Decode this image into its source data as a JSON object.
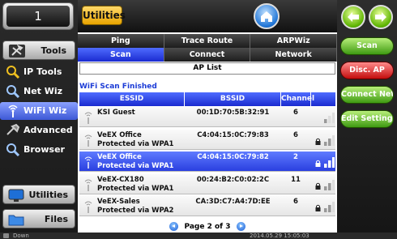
{
  "left_panel": {
    "port_label": "1",
    "tools_label": "Tools",
    "nav": [
      {
        "label": "IP Tools",
        "icon": "ip-tools-icon"
      },
      {
        "label": "Net Wiz",
        "icon": "net-wiz-icon"
      },
      {
        "label": "WiFi Wiz",
        "icon": "wifi-icon"
      },
      {
        "label": "Advanced",
        "icon": "advanced-icon"
      },
      {
        "label": "Browser",
        "icon": "browser-icon"
      }
    ],
    "utilities_label": "Utilities",
    "files_label": "Files"
  },
  "top_bar": {
    "app_title": "Utilities"
  },
  "tabs": {
    "row1": [
      "Ping",
      "Trace Route",
      "ARPWiz"
    ],
    "row2": [
      "Scan",
      "Connect",
      "Network"
    ],
    "active_row2": "Scan"
  },
  "ap_list": {
    "title": "AP List",
    "status": "WiFi Scan Finished",
    "columns": [
      "ESSID",
      "BSSID",
      "Channel"
    ],
    "rows": [
      {
        "essid": "KSI Guest",
        "security": "",
        "bssid": "00:1D:70:5B:32:91",
        "channel": "6",
        "locked": false,
        "signal": 1,
        "selected": false
      },
      {
        "essid": "VeEX Office",
        "security": "Protected via WPA1",
        "bssid": "C4:04:15:0C:79:83",
        "channel": "6",
        "locked": true,
        "signal": 2,
        "selected": false
      },
      {
        "essid": "VeEX Office",
        "security": "Protected via WPA1",
        "bssid": "C4:04:15:0C:79:82",
        "channel": "2",
        "locked": true,
        "signal": 3,
        "selected": true
      },
      {
        "essid": "VeEX-CX180",
        "security": "Protected via WPA1",
        "bssid": "00:24:B2:C0:02:2C",
        "channel": "11",
        "locked": true,
        "signal": 2,
        "selected": false
      },
      {
        "essid": "VeEX-Sales",
        "security": "Protected via WPA2",
        "bssid": "CA:3D:C7:A4:7D:EE",
        "channel": "6",
        "locked": true,
        "signal": 2,
        "selected": false
      }
    ],
    "pager": "Page 2 of 3"
  },
  "right_panel": {
    "buttons": [
      {
        "label": "Scan",
        "color": "green"
      },
      {
        "label": "Disc. AP",
        "color": "red"
      },
      {
        "label": "Connect Net",
        "color": "green"
      },
      {
        "label": "Edit Settings",
        "color": "green"
      }
    ]
  },
  "status_bar": {
    "link": "Down",
    "datetime": "2014.05.29  15:05:03"
  },
  "colors": {
    "accent_blue": "#1a2bd0",
    "utilities_gold": "#e8a400",
    "green_button": "#3e9a12",
    "red_button": "#c20d0d"
  }
}
